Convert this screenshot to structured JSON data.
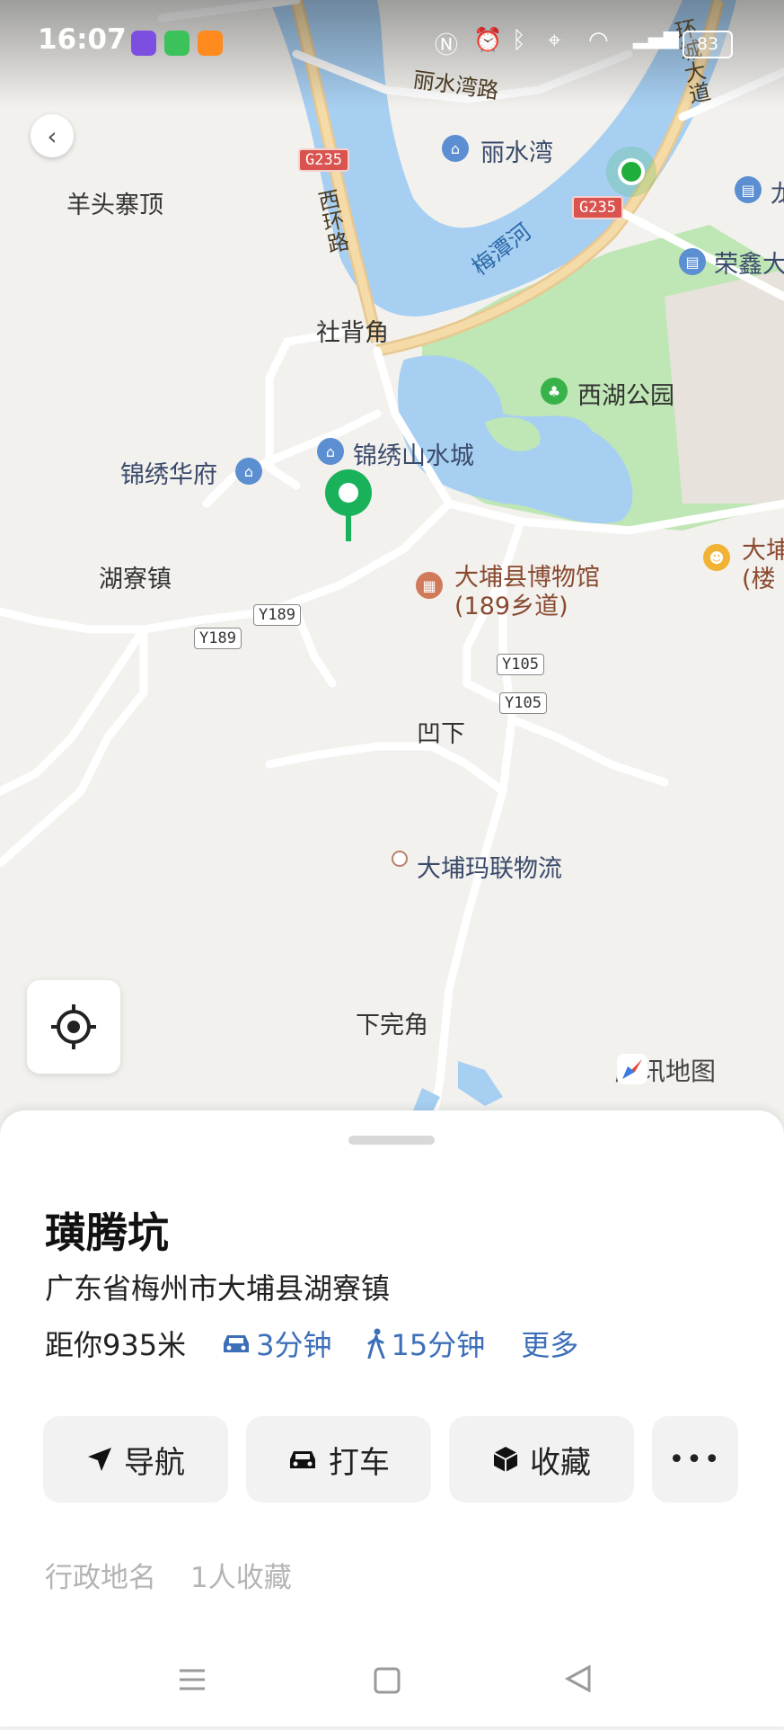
{
  "status_bar": {
    "time": "16:07",
    "battery": "83"
  },
  "map": {
    "labels": {
      "lishuiwan_road": "丽水湾路",
      "lishuiwan": "丽水湾",
      "yangtou": "羊头寨顶",
      "xihuan": "西环路",
      "meitan_river": "梅潭河",
      "shebeijiao": "社背角",
      "xihu_park": "西湖公园",
      "jinxiu_city": "锦绣山水城",
      "jinxiu_huafu": "锦绣华府",
      "huliao": "湖寮镇",
      "museum": "大埔县博物馆",
      "museum_sub": "(189乡道)",
      "aoxia": "凹下",
      "logistics": "大埔玛联物流",
      "xiawanjiao": "下完角",
      "rongxin": "荣鑫大",
      "huancheng": "环城大道",
      "dapu_right": "大埔",
      "loupan": "(楼",
      "long": "龙"
    },
    "shields": {
      "g235a": "G235",
      "g235b": "G235",
      "y189a": "Y189",
      "y189b": "Y189",
      "y105a": "Y105",
      "y105b": "Y105"
    },
    "brand": "腾讯地图"
  },
  "place": {
    "title": "璜腾坑",
    "address": "广东省梅州市大埔县湖寮镇",
    "distance": "距你935米",
    "drive": "3分钟",
    "walk": "15分钟",
    "more": "更多"
  },
  "actions": {
    "navigate": "导航",
    "taxi": "打车",
    "favorite": "收藏"
  },
  "tags": {
    "type": "行政地名",
    "favs": "1人收藏"
  }
}
